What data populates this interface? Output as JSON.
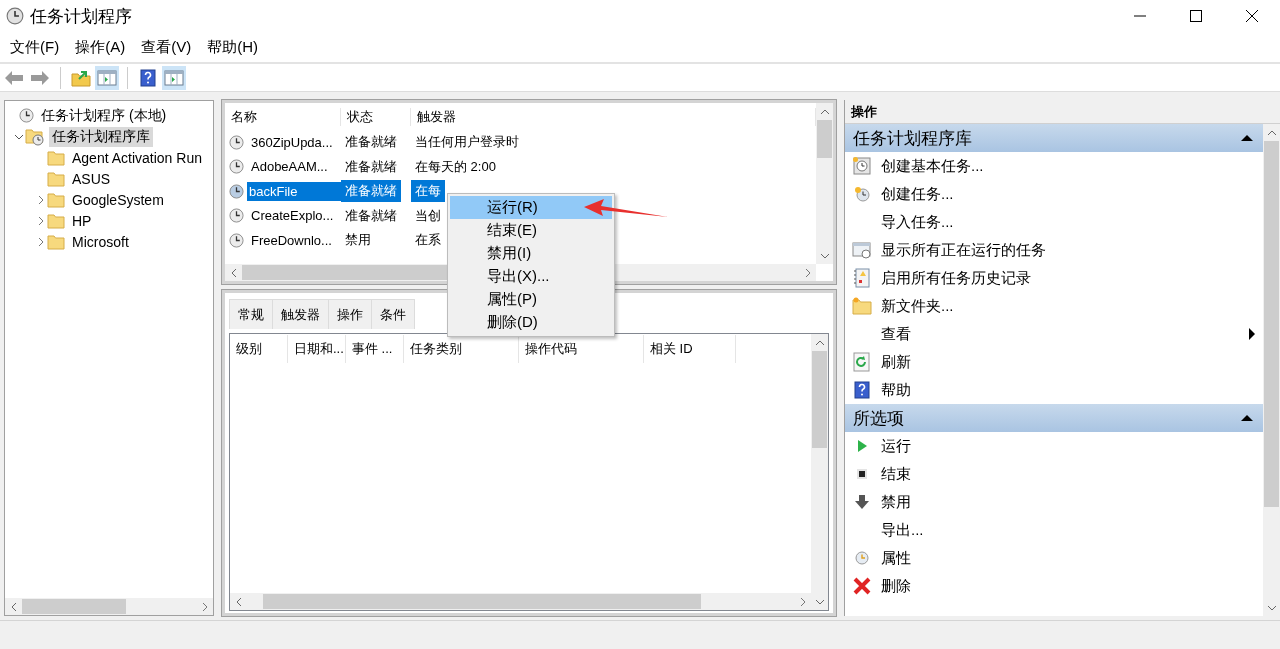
{
  "window": {
    "title": "任务计划程序"
  },
  "menu_bar": [
    "文件(F)",
    "操作(A)",
    "查看(V)",
    "帮助(H)"
  ],
  "toolbar": {
    "console_tree_shown": true,
    "action_pane_shown": true
  },
  "tree": {
    "items": [
      {
        "label": "任务计划程序 (本地)",
        "kind": "computer",
        "selected": false,
        "children": [
          {
            "label": "任务计划程序库",
            "kind": "library",
            "expanded": true,
            "selected": true,
            "children": [
              {
                "label": "Agent Activation Run",
                "kind": "folder",
                "selected": false
              },
              {
                "label": "ASUS",
                "kind": "folder",
                "selected": false
              },
              {
                "label": "GoogleSystem",
                "kind": "folder",
                "expanded": false,
                "selected": false
              },
              {
                "label": "HP",
                "kind": "folder",
                "expanded": false,
                "selected": false
              },
              {
                "label": "Microsoft",
                "kind": "folder",
                "expanded": false,
                "selected": false
              }
            ]
          }
        ]
      }
    ]
  },
  "task_list": {
    "columns": [
      "名称",
      "状态",
      "触发器"
    ],
    "rows": [
      {
        "name": "360ZipUpda...",
        "status": "准备就绪",
        "trigger": "当任何用户登录时",
        "selected": false
      },
      {
        "name": "AdobeAAM...",
        "status": "准备就绪",
        "trigger": "在每天的 2:00",
        "selected": false
      },
      {
        "name": "backFile",
        "status": "准备就绪",
        "trigger": "在每",
        "selected": true
      },
      {
        "name": "CreateExplo...",
        "status": "准备就绪",
        "trigger": "当创",
        "selected": false
      },
      {
        "name": "FreeDownlo...",
        "status": "禁用",
        "trigger": "在系",
        "selected": false
      }
    ]
  },
  "context_menu": {
    "items": [
      {
        "label": "运行(R)",
        "selected": true
      },
      {
        "label": "结束(E)",
        "selected": false
      },
      {
        "label": "禁用(I)",
        "selected": false
      },
      {
        "label": "导出(X)...",
        "selected": false
      },
      {
        "label": "属性(P)",
        "selected": false
      },
      {
        "label": "删除(D)",
        "selected": false
      }
    ]
  },
  "details": {
    "tabs": [
      {
        "label": "常规",
        "selected": false
      },
      {
        "label": "触发器",
        "selected": false
      },
      {
        "label": "操作",
        "selected": false
      },
      {
        "label": "条件",
        "selected": false
      }
    ],
    "columns": [
      "级别",
      "日期和...",
      "事件 ...",
      "任务类别",
      "操作代码",
      "相关 ID"
    ]
  },
  "actions": {
    "title": "操作",
    "sections": [
      {
        "title": "任务计划程序库",
        "expanded": true,
        "items": [
          {
            "label": "创建基本任务...",
            "kind": "basic_task",
            "submenu": false
          },
          {
            "label": "创建任务...",
            "kind": "task",
            "submenu": false
          },
          {
            "label": "导入任务...",
            "kind": "none",
            "submenu": false
          },
          {
            "label": "显示所有正在运行的任务",
            "kind": "running",
            "submenu": false
          },
          {
            "label": "启用所有任务历史记录",
            "kind": "history",
            "submenu": false
          },
          {
            "label": "新文件夹...",
            "kind": "folder",
            "submenu": false
          },
          {
            "label": "查看",
            "kind": "none",
            "submenu": true
          },
          {
            "label": "刷新",
            "kind": "refresh",
            "submenu": false
          },
          {
            "label": "帮助",
            "kind": "help",
            "submenu": false
          }
        ]
      },
      {
        "title": "所选项",
        "expanded": true,
        "items": [
          {
            "label": "运行",
            "kind": "run",
            "submenu": false
          },
          {
            "label": "结束",
            "kind": "end",
            "submenu": false
          },
          {
            "label": "禁用",
            "kind": "disable",
            "submenu": false
          },
          {
            "label": "导出...",
            "kind": "none",
            "submenu": false
          },
          {
            "label": "属性",
            "kind": "properties",
            "submenu": false
          },
          {
            "label": "删除",
            "kind": "delete",
            "submenu": false
          }
        ]
      }
    ]
  }
}
